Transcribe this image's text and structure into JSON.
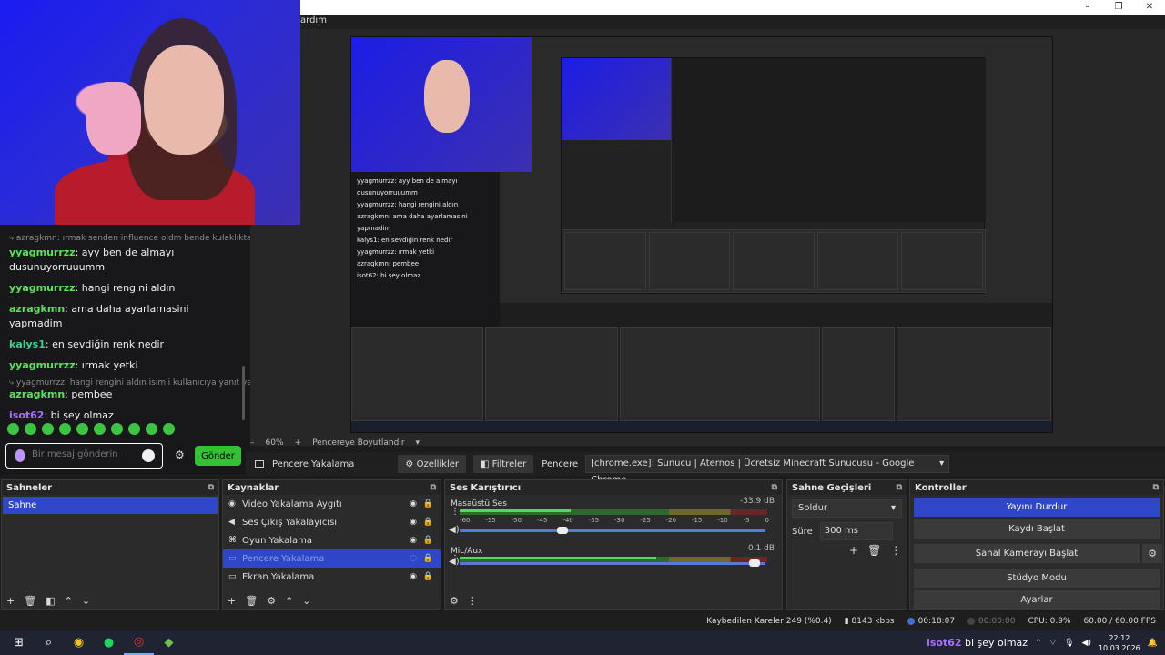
{
  "menubar": {
    "item": "ardım"
  },
  "window_controls": {
    "minimize": "–",
    "restore": "❐",
    "close": "✕"
  },
  "chat": {
    "reply_1": "⤷ azragkmn: ırmak senden influence oldm bende kulaklıktan ...",
    "reply_2": "⤷ yyagmurrzz: hangi rengini aldın isimli kullanıcıya yanıt veri...",
    "messages": [
      {
        "user": "yyagmurrzz",
        "color": "#5ee05e",
        "text": "ayy ben de almayı dusunuyorruuumm"
      },
      {
        "user": "yyagmurrzz",
        "color": "#5ee05e",
        "text": "hangi rengini aldın"
      },
      {
        "user": "azragkmn",
        "color": "#5ee05e",
        "text": "ama daha ayarlamasini yapmadim"
      },
      {
        "user": "kalys1",
        "color": "#3fcf8e",
        "text": "en sevdiğin renk nedir"
      },
      {
        "user": "yyagmurrzz",
        "color": "#5ee05e",
        "text": "ırmak yetki"
      },
      {
        "user": "azragkmn",
        "color": "#5ee05e",
        "text": "pembee"
      },
      {
        "user": "isot62",
        "color": "#a970ff",
        "text": "bi şey olmaz"
      }
    ],
    "input_placeholder": "Bir mesaj gönderin",
    "send_label": "Gönder"
  },
  "zoom": {
    "value": "60%",
    "plus": "+",
    "minus": "–",
    "fit_label": "Pencereye Boyutlandır"
  },
  "source_toolbar": {
    "source_name": "Pencere Yakalama",
    "properties_label": "Özellikler",
    "filters_label": "Filtreler",
    "window_label": "Pencere",
    "window_value": "[chrome.exe]: Sunucu | Aternos | Ücretsiz Minecraft Sunucusu - Google Chrome"
  },
  "scenes": {
    "title": "Sahneler",
    "items": [
      "Sahne"
    ]
  },
  "sources": {
    "title": "Kaynaklar",
    "items": [
      {
        "label": "Video Yakalama Aygıtı",
        "icon": "camera-icon"
      },
      {
        "label": "Ses Çıkış Yakalayıcısı",
        "icon": "speaker-icon"
      },
      {
        "label": "Oyun Yakalama",
        "icon": "gamepad-icon"
      },
      {
        "label": "Pencere Yakalama",
        "icon": "window-icon"
      },
      {
        "label": "Ekran Yakalama",
        "icon": "monitor-icon"
      }
    ]
  },
  "mixer": {
    "title": "Ses Karıştırıcı",
    "ticks": [
      "-60",
      "-55",
      "-50",
      "-45",
      "-40",
      "-35",
      "-30",
      "-25",
      "-20",
      "-15",
      "-10",
      "-5",
      "0"
    ],
    "channels": [
      {
        "name": "Masaüstü Ses",
        "db": "-33.9 dB",
        "level": 0.36,
        "volume": 0.33
      },
      {
        "name": "Mic/Aux",
        "db": "0.1 dB",
        "level": 0.64,
        "volume": 0.98
      }
    ]
  },
  "transitions": {
    "title": "Sahne Geçişleri",
    "type": "Soldur",
    "duration_label": "Süre",
    "duration_value": "300 ms"
  },
  "controls": {
    "title": "Kontroller",
    "stop_stream": "Yayını Durdur",
    "start_record": "Kaydı Başlat",
    "virtual_cam": "Sanal Kamerayı Başlat",
    "studio_mode": "Stüdyo Modu",
    "settings": "Ayarlar"
  },
  "status": {
    "dropped": "Kaybedilen Kareler 249 (%0.4)",
    "bitrate": "8143 kbps",
    "stream_time": "00:18:07",
    "record_time": "00:00:00",
    "cpu": "CPU: 0.9%",
    "fps": "60.00 / 60.00 FPS"
  },
  "taskbar": {
    "notification_user": "isot62",
    "notification_text": "bi şey olmaz",
    "time": "22:12",
    "date": "10.03.2026"
  },
  "nested": {
    "chat_lines": [
      "yyagmurrzz: ayy ben de almayı dusunuyorruuumm",
      "yyagmurrzz: hangi rengini aldın",
      "azragkmn: ama daha ayarlamasini yapmadim",
      "kalys1: en sevdiğin renk nedir",
      "yyagmurrzz: ırmak yetki",
      "azragkmn: pembee",
      "isot62: bi şey olmaz"
    ]
  }
}
